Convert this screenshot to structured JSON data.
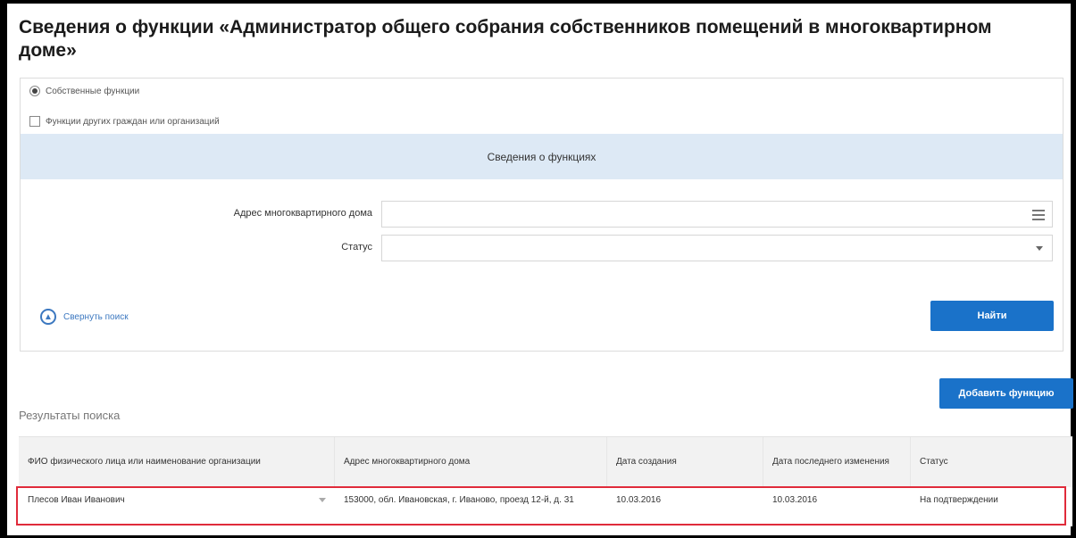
{
  "page": {
    "title": "Сведения о функции «Администратор общего собрания собственников помещений в многоквартирном доме»"
  },
  "filters": {
    "own_functions_label": "Собственные функции",
    "others_functions_label": "Функции других граждан или организаций"
  },
  "section": {
    "header": "Сведения о функциях"
  },
  "form": {
    "address_label": "Адрес многоквартирного дома",
    "address_value": "",
    "status_label": "Статус",
    "status_value": ""
  },
  "actions": {
    "collapse_label": "Свернуть поиск",
    "find_label": "Найти",
    "add_function_label": "Добавить функцию"
  },
  "results": {
    "label": "Результаты поиска",
    "columns": [
      "ФИО физического лица или наименование организации",
      "Адрес многоквартирного дома",
      "Дата создания",
      "Дата последнего изменения",
      "Статус"
    ],
    "rows": [
      {
        "name": "Плесов Иван Иванович",
        "address": "153000, обл. Ивановская, г. Иваново, проезд 12-й, д. 31",
        "created": "10.03.2016",
        "modified": "10.03.2016",
        "status": "На подтверждении"
      }
    ]
  },
  "colors": {
    "accent": "#1a72c9",
    "section_band": "#dde9f5",
    "highlight": "#e02b3b"
  }
}
